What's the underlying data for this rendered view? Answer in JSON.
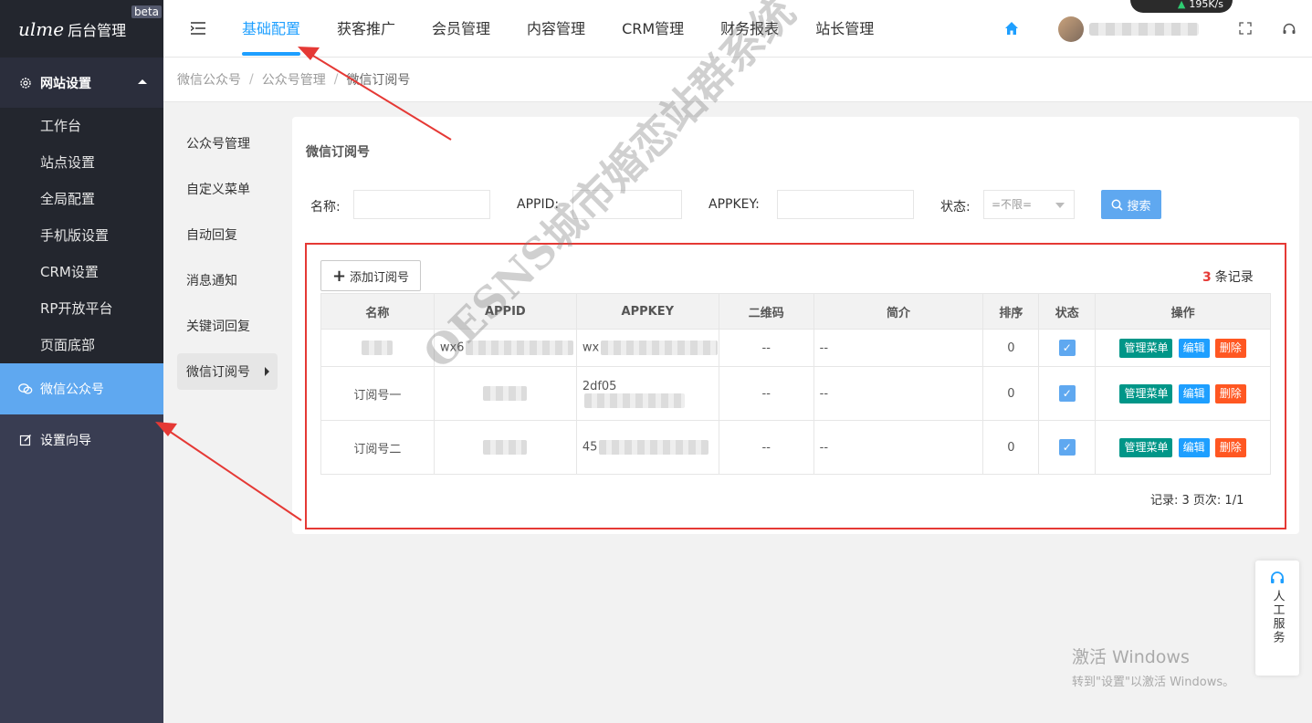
{
  "brand": {
    "logo": "ulme",
    "title": "后台管理",
    "badge": "beta"
  },
  "sidebar": {
    "group": {
      "label": "网站设置",
      "icon": "gear-icon"
    },
    "sub_items": [
      "工作台",
      "站点设置",
      "全局配置",
      "手机版设置",
      "CRM设置",
      "RP开放平台",
      "页面底部"
    ],
    "items": [
      {
        "label": "微信公众号",
        "icon": "wechat-icon",
        "active": true
      },
      {
        "label": "设置向导",
        "icon": "edit-icon",
        "active": false
      }
    ]
  },
  "header": {
    "tabs": [
      {
        "label": "基础配置",
        "active": true
      },
      {
        "label": "获客推广"
      },
      {
        "label": "会员管理"
      },
      {
        "label": "内容管理"
      },
      {
        "label": "CRM管理"
      },
      {
        "label": "财务报表"
      },
      {
        "label": "站长管理"
      }
    ],
    "speed": "195",
    "speed_unit": "K/s"
  },
  "breadcrumb": [
    "微信公众号",
    "公众号管理",
    "微信订阅号"
  ],
  "breadcrumb_sep": "/",
  "sub_nav": [
    "公众号管理",
    "自定义菜单",
    "自动回复",
    "消息通知",
    "关键词回复",
    "微信订阅号"
  ],
  "card": {
    "title": "微信订阅号",
    "filters": {
      "name_label": "名称:",
      "appid_label": "APPID:",
      "appkey_label": "APPKEY:",
      "status_label": "状态:",
      "status_value": "=不限=",
      "search_label": "搜索"
    },
    "add_label": "添加订阅号",
    "record_count": "3",
    "record_count_suffix": "条记录",
    "columns": [
      "名称",
      "APPID",
      "APPKEY",
      "二维码",
      "简介",
      "排序",
      "状态",
      "操作"
    ],
    "rows": [
      {
        "name": "",
        "appid": "wx6",
        "appkey": "wx",
        "qrcode": "--",
        "intro": "--",
        "sort": "0"
      },
      {
        "name": "订阅号一",
        "appid": "",
        "appkey": "2df05",
        "qrcode": "--",
        "intro": "--",
        "sort": "0"
      },
      {
        "name": "订阅号二",
        "appid": "",
        "appkey": "45",
        "qrcode": "--",
        "intro": "--",
        "sort": "0"
      }
    ],
    "ops": {
      "manage": "管理菜单",
      "edit": "编辑",
      "delete": "删除"
    },
    "pager": "记录: 3  页次: 1/1"
  },
  "watermark": "OESNS城市婚恋站群系统",
  "service": {
    "label": "人工服务"
  },
  "activation": {
    "line1": "激活 Windows",
    "line2": "转到\"设置\"以激活 Windows。"
  },
  "colors": {
    "accent": "#1e9fff",
    "sidebar": "#393d52",
    "active": "#5fa8f0",
    "highlight": "#e53935"
  }
}
